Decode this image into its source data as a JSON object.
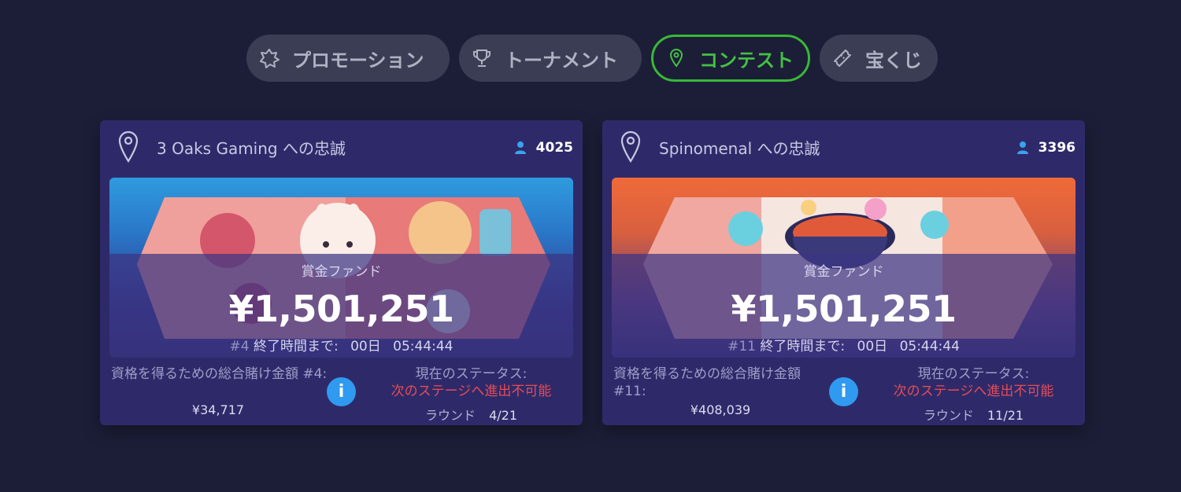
{
  "tabs": [
    {
      "label": "プロモーション",
      "icon": "promo-burst-icon",
      "active": false
    },
    {
      "label": "トーナメント",
      "icon": "trophy-icon",
      "active": false
    },
    {
      "label": "コンテスト",
      "icon": "location-pin-icon",
      "active": true
    },
    {
      "label": "宝くじ",
      "icon": "ticket-icon",
      "active": false
    }
  ],
  "colors": {
    "background": "#1c1e37",
    "card": "#2e2a6a",
    "active_tab": "#39b838",
    "info": "#2f9af0",
    "status_red": "#e74b55"
  },
  "cards": [
    {
      "title": "3 Oaks Gaming への忠誠",
      "players": "4025",
      "fund_label": "賞金ファンド",
      "fund_amount": "¥1,501,251",
      "rank": "#4",
      "timer_label": "終了時間まで:",
      "days": "00日",
      "time": "05:44:44",
      "requirement_label": "資格を得るための総合賭け金額 #4:",
      "requirement_value": "¥34,717",
      "info": "i",
      "status_label": "現在のステータス:",
      "status_value": "次のステージへ進出不可能",
      "round_label": "ラウンド",
      "round_value": "4/21"
    },
    {
      "title": "Spinomenal への忠誠",
      "players": "3396",
      "fund_label": "賞金ファンド",
      "fund_amount": "¥1,501,251",
      "rank": "#11",
      "timer_label": "終了時間まで:",
      "days": "00日",
      "time": "05:44:44",
      "requirement_label": "資格を得るための総合賭け金額 #11:",
      "requirement_value": "¥408,039",
      "info": "i",
      "status_label": "現在のステータス:",
      "status_value": "次のステージへ進出不可能",
      "round_label": "ラウンド",
      "round_value": "11/21"
    }
  ]
}
